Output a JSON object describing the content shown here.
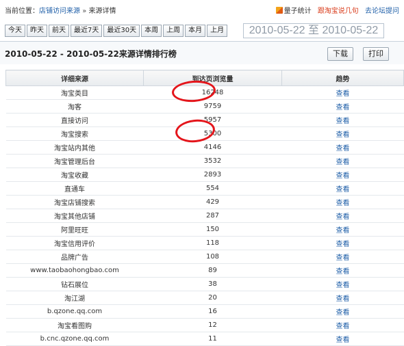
{
  "breadcrumb": {
    "label": "当前位置：",
    "items": [
      "店铺访问来源",
      "来源详情"
    ],
    "separator": "»"
  },
  "top_links": {
    "brand": "量子统计",
    "items": [
      "跟淘宝说几句",
      "去论坛提问"
    ]
  },
  "date_buttons": [
    "今天",
    "昨天",
    "前天",
    "最近7天",
    "最近30天",
    "本周",
    "上周",
    "本月",
    "上月"
  ],
  "date_range": "2010-05-22 至 2010-05-22",
  "panel": {
    "title": "2010-05-22 - 2010-05-22来源详情排行榜",
    "download": "下载",
    "print": "打印"
  },
  "table": {
    "headers": [
      "详细来源",
      "到达页浏览量",
      "趋势"
    ],
    "rows": [
      {
        "source": "淘宝类目",
        "views": "16248",
        "trend": "查看"
      },
      {
        "source": "淘客",
        "views": "9759",
        "trend": "查看"
      },
      {
        "source": "直接访问",
        "views": "5957",
        "trend": "查看"
      },
      {
        "source": "淘宝搜索",
        "views": "5300",
        "trend": "查看"
      },
      {
        "source": "淘宝站内其他",
        "views": "4146",
        "trend": "查看"
      },
      {
        "source": "淘宝管理后台",
        "views": "3532",
        "trend": "查看"
      },
      {
        "source": "淘宝收藏",
        "views": "2893",
        "trend": "查看"
      },
      {
        "source": "直通车",
        "views": "554",
        "trend": "查看"
      },
      {
        "source": "淘宝店铺搜索",
        "views": "429",
        "trend": "查看"
      },
      {
        "source": "淘宝其他店铺",
        "views": "287",
        "trend": "查看"
      },
      {
        "source": "阿里旺旺",
        "views": "150",
        "trend": "查看"
      },
      {
        "source": "淘宝信用评价",
        "views": "118",
        "trend": "查看"
      },
      {
        "source": "品牌广告",
        "views": "108",
        "trend": "查看"
      },
      {
        "source": "www.taobaohongbao.com",
        "views": "89",
        "trend": "查看"
      },
      {
        "source": "钻石展位",
        "views": "38",
        "trend": "查看"
      },
      {
        "source": "淘江湖",
        "views": "20",
        "trend": "查看"
      },
      {
        "source": "b.qzone.qq.com",
        "views": "16",
        "trend": "查看"
      },
      {
        "source": "淘宝看图购",
        "views": "12",
        "trend": "查看"
      },
      {
        "source": "b.cnc.qzone.qq.com",
        "views": "11",
        "trend": "查看"
      }
    ]
  },
  "colors": {
    "link": "#1f5fa8",
    "annotation": "#e4151b",
    "range_text": "#8f9aa6"
  }
}
